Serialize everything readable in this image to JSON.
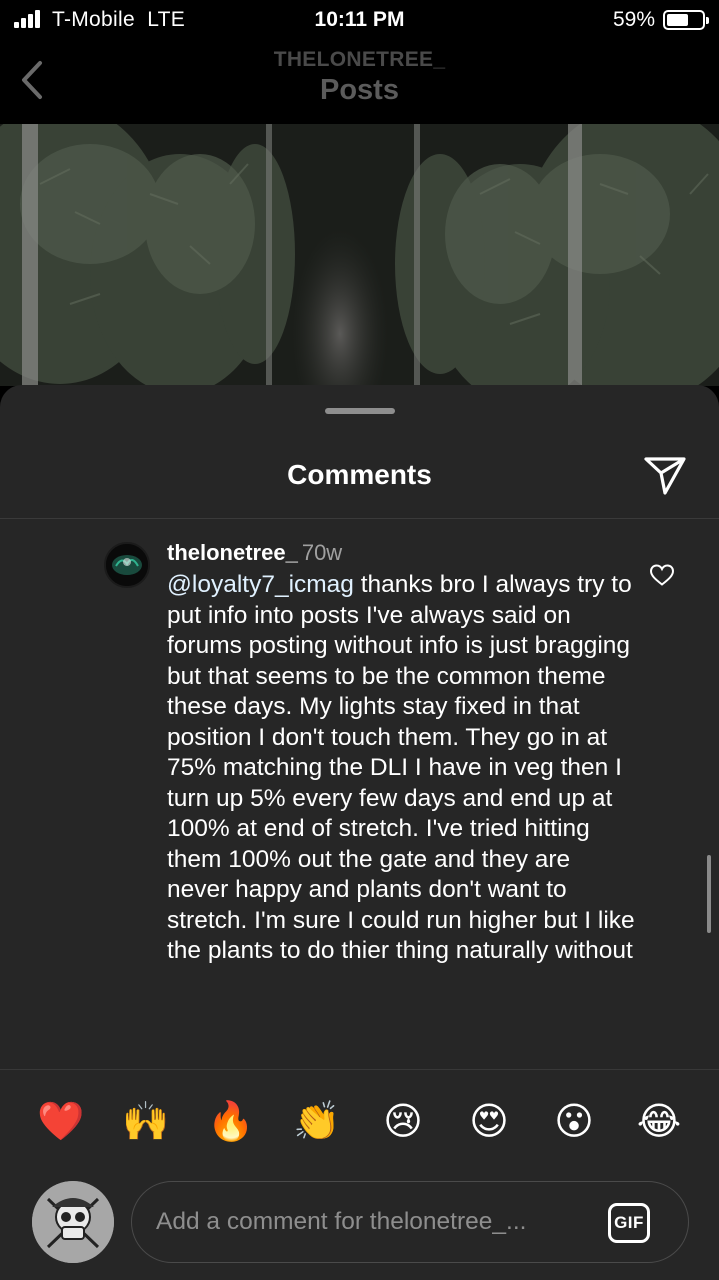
{
  "status_bar": {
    "carrier": "T-Mobile  LTE",
    "time": "10:11 PM",
    "battery_percent": "59%",
    "battery_level": 0.59,
    "signal_bars": 4
  },
  "nav": {
    "username": "THELONETREE_",
    "title": "Posts",
    "back_icon": "chevron-left-icon"
  },
  "comments_sheet": {
    "title": "Comments",
    "share_icon": "paper-plane-icon",
    "comment": {
      "username": "thelonetree_",
      "time": "70w",
      "mention": "@loyalty7_icmag",
      "text": " thanks bro I always try to put info into posts I've always said on forums posting without info is just bragging but that seems to be the common theme these days. My lights stay fixed in that position I don't touch them. They go in at 75% matching the DLI I have in veg then I turn up 5% every few days and end up at 100% at end of stretch. I've tried hitting them 100% out the gate and they are never happy and plants don't want to stretch. I'm sure I could run higher but I like the plants to do thier thing naturally without",
      "like_icon": "heart-outline-icon"
    }
  },
  "emoji_bar": {
    "emojis": [
      "❤️",
      "🙌",
      "🔥",
      "👏",
      "😢",
      "😍",
      "😮",
      "😂"
    ]
  },
  "comment_input": {
    "placeholder": "Add a comment for thelonetree_...",
    "gif_label": "GIF"
  },
  "colors": {
    "sheet_bg": "#262626",
    "text": "#ffffff",
    "muted_text": "#a0a0a0",
    "placeholder": "#8e8e8e"
  }
}
